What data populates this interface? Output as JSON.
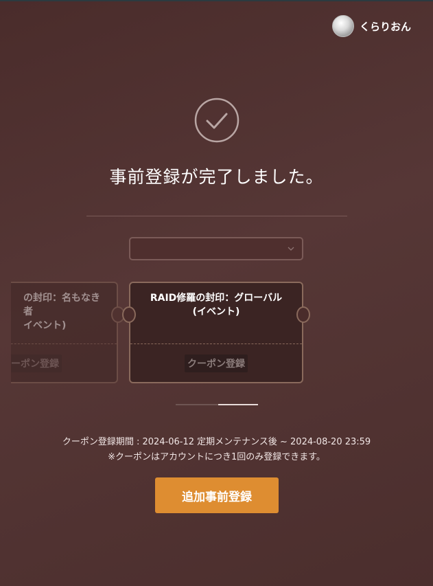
{
  "user": {
    "name": "くらりおん"
  },
  "title": "事前登録が完了しました。",
  "select": {
    "value": ""
  },
  "coupons": [
    {
      "name": "RAID修羅の封印：名もなき者（イベント）",
      "name_visible": "の封印：名もなき者\nイベント)",
      "button": "クーポン登録",
      "button_visible": "ーポン登録"
    },
    {
      "name": "RAID修羅の封印：グローバル\n(イベント)",
      "button": "クーポン登録"
    }
  ],
  "carousel": {
    "pages": 2,
    "current": 2
  },
  "period_text": "クーポン登録期間 : 2024-06-12 定期メンテナンス後 ~ 2024-08-20 23:59",
  "note_text": "※クーポンはアカウントにつき1回のみ登録できます。",
  "add_button": "追加事前登録",
  "colors": {
    "accent": "#de8d31",
    "background": "#4f2f2e",
    "card_border": "#8a6a5c"
  },
  "icons": {
    "check": "check-circle-icon",
    "chevron": "chevron-down-icon"
  }
}
